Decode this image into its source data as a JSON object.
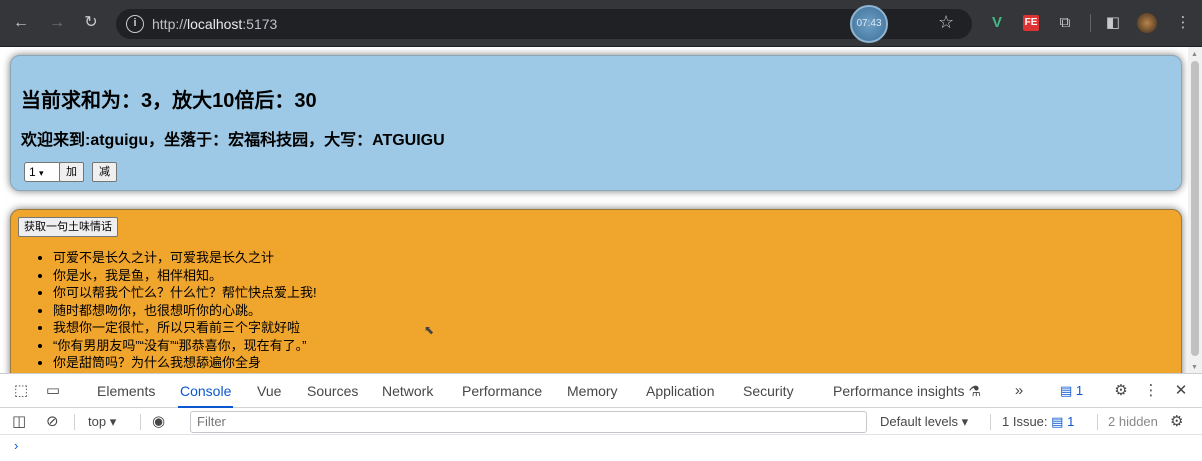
{
  "browser": {
    "url_prefix": "http://",
    "url_host": "localhost",
    "url_port": ":5173",
    "clock_time": "07:43"
  },
  "box1": {
    "sum_heading": "当前求和为：3，放大10倍后：30",
    "welcome": "欢迎来到:atguigu，坐落于：宏福科技园，大写：ATGUIGU",
    "select_value": "1",
    "add_label": "加",
    "sub_label": "减"
  },
  "box2": {
    "button_label": "获取一句土味情话",
    "items": [
      "可爱不是长久之计，可爱我是长久之计",
      "你是水，我是鱼，相伴相知。",
      "你可以帮我个忙么？什么忙？帮忙快点爱上我!",
      "随时都想吻你，也很想听你的心跳。",
      "我想你一定很忙，所以只看前三个字就好啦",
      "“你有男朋友吗”“没有”“那恭喜你，现在有了。”",
      "你是甜筒吗？为什么我想舔遍你全身"
    ]
  },
  "devtools": {
    "tabs": [
      "Elements",
      "Console",
      "Vue",
      "Sources",
      "Network",
      "Performance",
      "Memory",
      "Application",
      "Security",
      "Performance insights"
    ],
    "active_tab": "Console",
    "issues_badge": "1",
    "context": "top",
    "filter_placeholder": "Filter",
    "default_levels": "Default levels",
    "issue_label": "1 Issue:",
    "issue_count": "1",
    "hidden_label": "2 hidden",
    "prompt": "›"
  }
}
